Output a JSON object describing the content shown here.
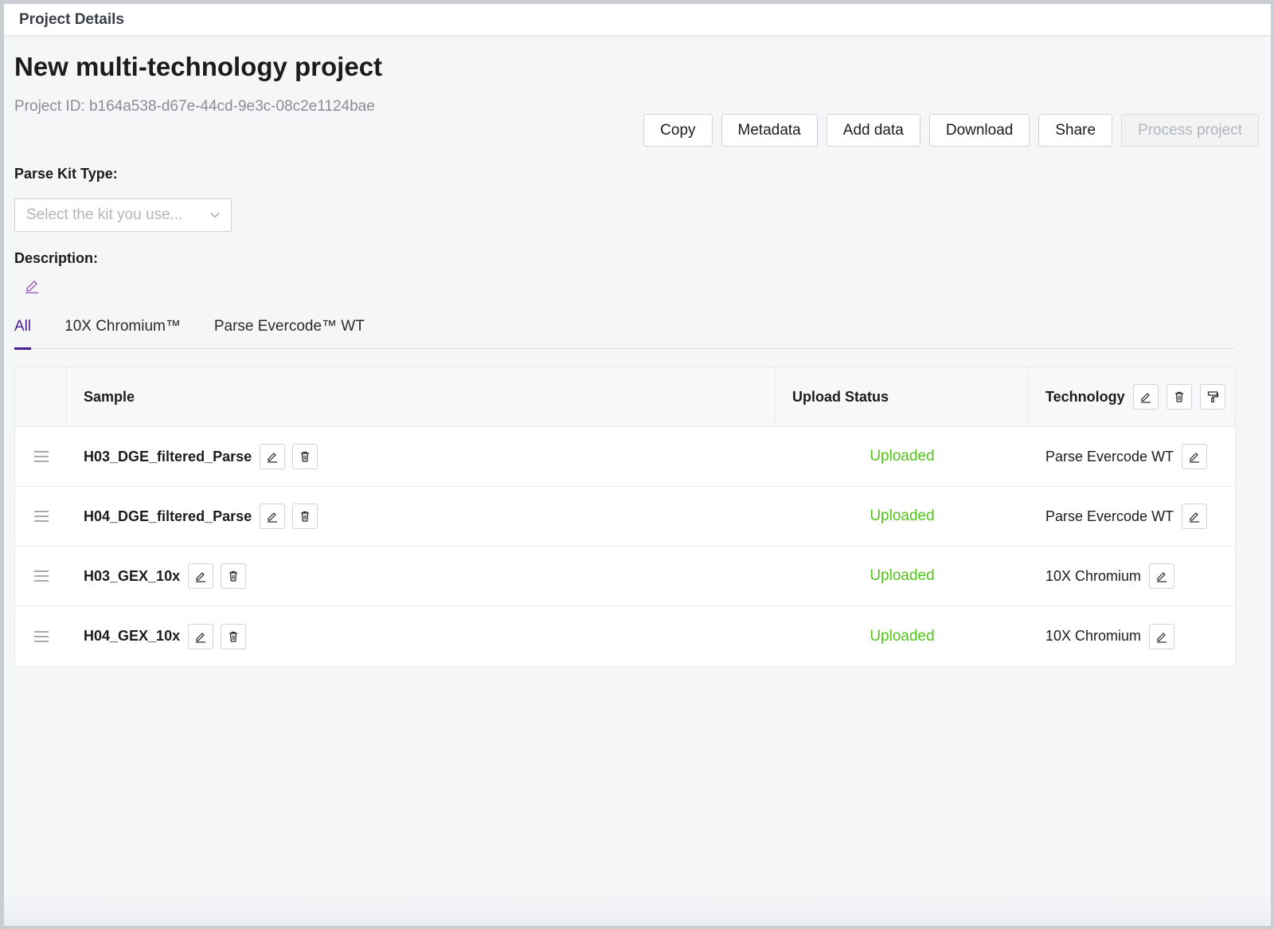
{
  "header": {
    "title": "Project Details"
  },
  "project": {
    "name": "New multi-technology project",
    "id_text": "Project ID: b164a538-d67e-44cd-9e3c-08c2e1124bae"
  },
  "actions": {
    "copy": "Copy",
    "metadata": "Metadata",
    "add_data": "Add data",
    "download": "Download",
    "share": "Share",
    "process": "Process project"
  },
  "kit": {
    "label": "Parse Kit Type:",
    "placeholder": "Select the kit you use..."
  },
  "description": {
    "label": "Description:"
  },
  "tabs": [
    {
      "label": "All",
      "active": true
    },
    {
      "label": "10X Chromium™",
      "active": false
    },
    {
      "label": "Parse Evercode™ WT",
      "active": false
    }
  ],
  "table": {
    "columns": {
      "sample": "Sample",
      "status": "Upload Status",
      "technology": "Technology"
    },
    "rows": [
      {
        "sample": "H03_DGE_filtered_Parse",
        "status": "Uploaded",
        "technology": "Parse Evercode WT"
      },
      {
        "sample": "H04_DGE_filtered_Parse",
        "status": "Uploaded",
        "technology": "Parse Evercode WT"
      },
      {
        "sample": "H03_GEX_10x",
        "status": "Uploaded",
        "technology": "10X Chromium"
      },
      {
        "sample": "H04_GEX_10x",
        "status": "Uploaded",
        "technology": "10X Chromium"
      }
    ]
  },
  "colors": {
    "accent": "#4b1d8f",
    "status_ok": "#52c41a",
    "edit_icon_purple": "#9b59b6"
  },
  "icons": {
    "edit": "pencil-icon",
    "delete": "trash-icon",
    "format": "paint-roller-icon",
    "drag": "drag-handle-icon",
    "dropdown": "chevron-down-icon"
  }
}
